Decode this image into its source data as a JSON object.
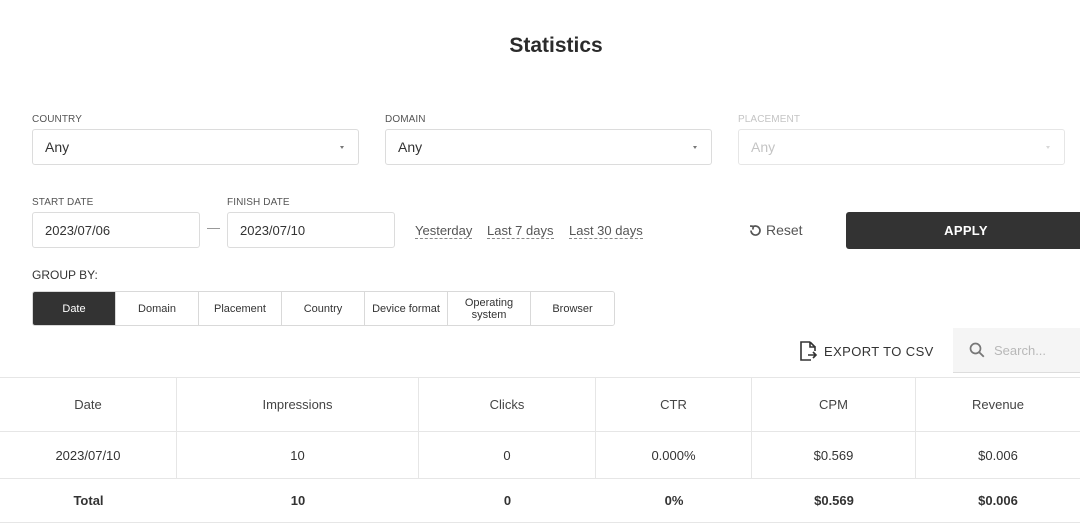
{
  "page": {
    "title": "Statistics"
  },
  "filters": {
    "country": {
      "label": "COUNTRY",
      "value": "Any"
    },
    "domain": {
      "label": "DOMAIN",
      "value": "Any"
    },
    "placement": {
      "label": "PLACEMENT",
      "value": "Any",
      "disabled": true
    }
  },
  "dates": {
    "start_label": "START DATE",
    "start_value": "2023/07/06",
    "finish_label": "FINISH DATE",
    "finish_value": "2023/07/10",
    "quick_links": [
      "Yesterday",
      "Last 7 days",
      "Last 30 days"
    ]
  },
  "actions": {
    "reset_label": "Reset",
    "apply_label": "APPLY"
  },
  "group_by": {
    "label": "GROUP BY:",
    "options": [
      "Date",
      "Domain",
      "Placement",
      "Country",
      "Device format",
      "Operating system",
      "Browser"
    ],
    "selected": "Date"
  },
  "toolbar": {
    "export_label": "EXPORT TO CSV",
    "search_placeholder": "Search..."
  },
  "table": {
    "columns": [
      "Date",
      "Impressions",
      "Clicks",
      "CTR",
      "CPM",
      "Revenue"
    ],
    "rows": [
      [
        "2023/07/10",
        "10",
        "0",
        "0.000%",
        "$0.569",
        "$0.006"
      ]
    ],
    "total": [
      "Total",
      "10",
      "0",
      "0%",
      "$0.569",
      "$0.006"
    ]
  }
}
